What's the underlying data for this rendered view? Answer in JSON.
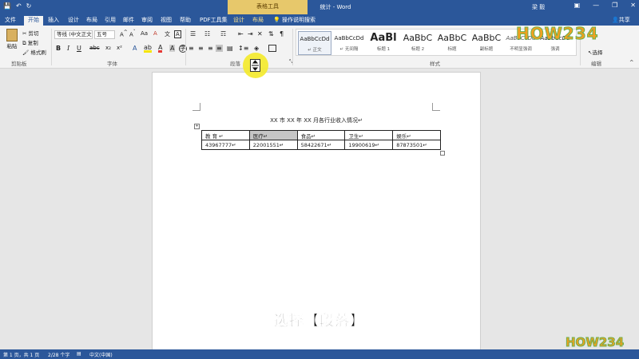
{
  "titlebar": {
    "context_tab": "表格工具",
    "window_title": "统计 - Word",
    "user": "梁 毅"
  },
  "tabs": [
    "文件",
    "开始",
    "插入",
    "设计",
    "布局",
    "引用",
    "邮件",
    "审阅",
    "视图",
    "帮助",
    "PDF工具集",
    "设计",
    "布局",
    "操作说明搜索"
  ],
  "share": "共享",
  "clipboard": {
    "paste": "粘贴",
    "cut": "剪切",
    "copy": "复制",
    "format_painter": "格式刷",
    "label": "剪贴板"
  },
  "font": {
    "name": "等线 (中文正文",
    "size": "五号",
    "label": "字体"
  },
  "paragraph": {
    "label": "段落"
  },
  "styles": {
    "label": "样式",
    "items": [
      {
        "preview": "AaBbCcDd",
        "name": "↵ 正文"
      },
      {
        "preview": "AaBbCcDd",
        "name": "↵ 无间隔"
      },
      {
        "preview": "AaBl",
        "name": "标题 1"
      },
      {
        "preview": "AaBbC",
        "name": "标题 2"
      },
      {
        "preview": "AaBbC",
        "name": "标题"
      },
      {
        "preview": "AaBbC",
        "name": "副标题"
      },
      {
        "preview": "AaBbCcDd",
        "name": "不明显强调"
      },
      {
        "preview": "AaBbCcDd",
        "name": "强调"
      }
    ]
  },
  "editing": {
    "select": "选择",
    "label": "编辑"
  },
  "document": {
    "title": "XX 市 XX 年 XX 月各行业收入情况↵",
    "table": {
      "headers": [
        "教 育 ↵",
        "医疗↵",
        "食品↵",
        "卫生↵",
        "娱乐↵"
      ],
      "row": [
        "43967777↵",
        "22001551↵",
        "58422671↵",
        "19900619↵",
        "87873501↵"
      ]
    }
  },
  "subtitle": "选择【段落】",
  "status": {
    "page": "第 1 页，共 1 页",
    "words": "2/28 个字",
    "lang": "中文(中国)"
  },
  "watermark": "HOW234"
}
